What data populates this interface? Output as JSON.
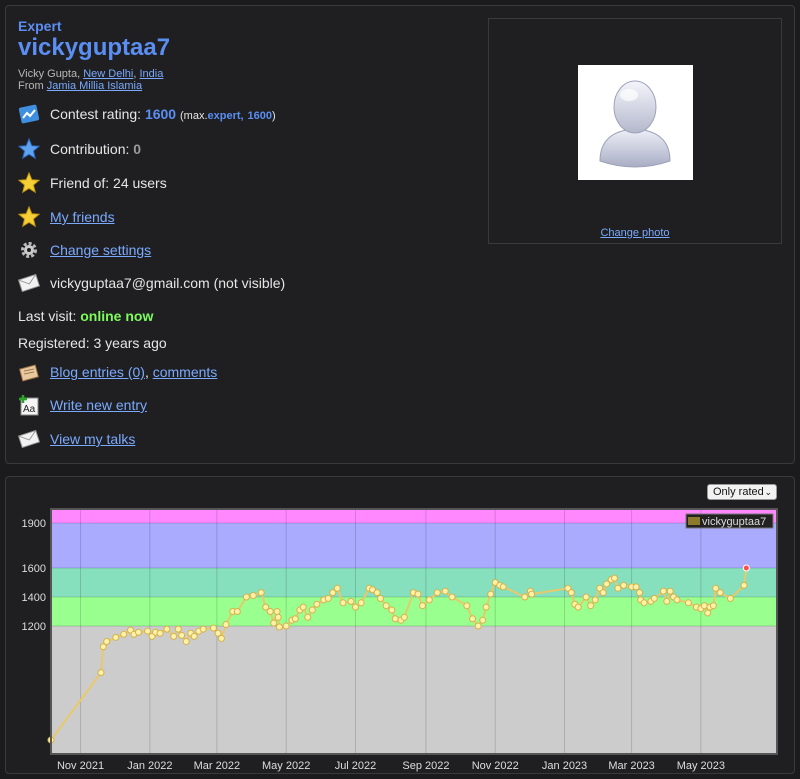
{
  "profile": {
    "rank": "Expert",
    "handle": "vickyguptaa7",
    "name": "Vicky Gupta",
    "city": "New Delhi",
    "country": "India",
    "from_label": "From",
    "organization": "Jamia Millia Islamia",
    "contest_rating_label": "Contest rating:",
    "contest_rating": "1600",
    "max_prefix": "(max.",
    "max_rank": "expert,",
    "max_rating": "1600",
    "max_suffix": ")",
    "contribution_label": "Contribution:",
    "contribution": "0",
    "friend_of": "Friend of: 24 users",
    "my_friends": "My friends",
    "change_settings": "Change settings",
    "email": "vickyguptaa7@gmail.com (not visible)",
    "last_visit_label": "Last visit:",
    "last_visit": "online now",
    "registered": "Registered: 3 years ago",
    "blog_entries": "Blog entries (0)",
    "comments": "comments",
    "write_entry": "Write new entry",
    "view_talks": "View my talks",
    "change_photo": "Change photo"
  },
  "icons": [
    "rating-icon",
    "star-blue-icon",
    "star-gold-icon",
    "star-gold-icon",
    "gear-icon",
    "envelope-icon",
    "blog-icon",
    "write-icon",
    "talks-icon"
  ],
  "graph": {
    "filter_selected": "Only rated"
  },
  "chart_data": {
    "type": "line",
    "legend": "vickyguptaa7",
    "legend_position": "top-right",
    "x_ticks": [
      "Nov 2021",
      "Jan 2022",
      "Mar 2022",
      "May 2022",
      "Jul 2022",
      "Sep 2022",
      "Nov 2022",
      "Jan 2023",
      "Mar 2023",
      "May 2023"
    ],
    "y_ticks": [
      1200,
      1400,
      1600,
      1900
    ],
    "ylim": [
      0,
      2000
    ],
    "bands": [
      {
        "from": 0,
        "to": 1200,
        "color": "#cccccc"
      },
      {
        "from": 1200,
        "to": 1400,
        "color": "#99ff8f"
      },
      {
        "from": 1400,
        "to": 1600,
        "color": "#86dfbd"
      },
      {
        "from": 1600,
        "to": 1900,
        "color": "#aaaaff"
      },
      {
        "from": 1900,
        "to": 2000,
        "color": "#ff88ff"
      }
    ],
    "line_color": "#e8c96a",
    "x_range": [
      "2021-10-06",
      "2023-07-07"
    ],
    "series": [
      {
        "name": "vickyguptaa7",
        "points": [
          [
            "2021-10-06",
            100
          ],
          [
            "2021-11-19",
            750
          ],
          [
            "2021-11-21",
            1000
          ],
          [
            "2021-11-24",
            1050
          ],
          [
            "2021-12-02",
            1090
          ],
          [
            "2021-12-09",
            1120
          ],
          [
            "2021-12-15",
            1160
          ],
          [
            "2021-12-18",
            1120
          ],
          [
            "2021-12-22",
            1140
          ],
          [
            "2021-12-30",
            1150
          ],
          [
            "2022-01-03",
            1100
          ],
          [
            "2022-01-06",
            1140
          ],
          [
            "2022-01-10",
            1130
          ],
          [
            "2022-01-16",
            1170
          ],
          [
            "2022-01-22",
            1100
          ],
          [
            "2022-01-26",
            1170
          ],
          [
            "2022-01-29",
            1110
          ],
          [
            "2022-02-02",
            1050
          ],
          [
            "2022-02-06",
            1130
          ],
          [
            "2022-02-09",
            1100
          ],
          [
            "2022-02-13",
            1150
          ],
          [
            "2022-02-17",
            1170
          ],
          [
            "2022-02-26",
            1180
          ],
          [
            "2022-03-02",
            1130
          ],
          [
            "2022-03-05",
            1080
          ],
          [
            "2022-03-09",
            1210
          ],
          [
            "2022-03-15",
            1300
          ],
          [
            "2022-03-19",
            1300
          ],
          [
            "2022-03-27",
            1400
          ],
          [
            "2022-04-02",
            1410
          ],
          [
            "2022-04-09",
            1430
          ],
          [
            "2022-04-13",
            1330
          ],
          [
            "2022-04-17",
            1300
          ],
          [
            "2022-04-20",
            1220
          ],
          [
            "2022-04-23",
            1300
          ],
          [
            "2022-04-24",
            1260
          ],
          [
            "2022-04-25",
            1190
          ],
          [
            "2022-05-01",
            1200
          ],
          [
            "2022-05-06",
            1240
          ],
          [
            "2022-05-09",
            1250
          ],
          [
            "2022-05-13",
            1310
          ],
          [
            "2022-05-16",
            1330
          ],
          [
            "2022-05-20",
            1260
          ],
          [
            "2022-05-24",
            1310
          ],
          [
            "2022-05-28",
            1350
          ],
          [
            "2022-06-03",
            1380
          ],
          [
            "2022-06-07",
            1390
          ],
          [
            "2022-06-11",
            1430
          ],
          [
            "2022-06-15",
            1460
          ],
          [
            "2022-06-20",
            1360
          ],
          [
            "2022-06-27",
            1370
          ],
          [
            "2022-07-01",
            1330
          ],
          [
            "2022-07-06",
            1360
          ],
          [
            "2022-07-13",
            1460
          ],
          [
            "2022-07-16",
            1450
          ],
          [
            "2022-07-20",
            1430
          ],
          [
            "2022-07-23",
            1390
          ],
          [
            "2022-07-28",
            1340
          ],
          [
            "2022-08-02",
            1310
          ],
          [
            "2022-08-05",
            1250
          ],
          [
            "2022-08-10",
            1240
          ],
          [
            "2022-08-13",
            1260
          ],
          [
            "2022-08-21",
            1430
          ],
          [
            "2022-08-25",
            1420
          ],
          [
            "2022-08-29",
            1340
          ],
          [
            "2022-09-04",
            1380
          ],
          [
            "2022-09-11",
            1430
          ],
          [
            "2022-09-18",
            1440
          ],
          [
            "2022-09-24",
            1400
          ],
          [
            "2022-10-07",
            1340
          ],
          [
            "2022-10-12",
            1250
          ],
          [
            "2022-10-17",
            1200
          ],
          [
            "2022-10-21",
            1240
          ],
          [
            "2022-10-24",
            1330
          ],
          [
            "2022-10-28",
            1420
          ],
          [
            "2022-11-01",
            1500
          ],
          [
            "2022-11-05",
            1480
          ],
          [
            "2022-11-08",
            1470
          ],
          [
            "2022-11-27",
            1400
          ],
          [
            "2022-12-02",
            1440
          ],
          [
            "2022-12-03",
            1420
          ],
          [
            "2023-01-04",
            1460
          ],
          [
            "2023-01-07",
            1430
          ],
          [
            "2023-01-10",
            1350
          ],
          [
            "2023-01-13",
            1330
          ],
          [
            "2023-01-20",
            1400
          ],
          [
            "2023-01-24",
            1340
          ],
          [
            "2023-01-28",
            1380
          ],
          [
            "2023-02-01",
            1460
          ],
          [
            "2023-02-04",
            1430
          ],
          [
            "2023-02-07",
            1490
          ],
          [
            "2023-02-11",
            1520
          ],
          [
            "2023-02-14",
            1530
          ],
          [
            "2023-02-17",
            1460
          ],
          [
            "2023-02-22",
            1480
          ],
          [
            "2023-03-01",
            1470
          ],
          [
            "2023-03-05",
            1470
          ],
          [
            "2023-03-08",
            1430
          ],
          [
            "2023-03-09",
            1380
          ],
          [
            "2023-03-12",
            1360
          ],
          [
            "2023-03-18",
            1370
          ],
          [
            "2023-03-21",
            1390
          ],
          [
            "2023-03-29",
            1440
          ],
          [
            "2023-04-01",
            1370
          ],
          [
            "2023-04-04",
            1440
          ],
          [
            "2023-04-07",
            1400
          ],
          [
            "2023-04-10",
            1380
          ],
          [
            "2023-04-20",
            1360
          ],
          [
            "2023-04-27",
            1330
          ],
          [
            "2023-05-01",
            1320
          ],
          [
            "2023-05-04",
            1340
          ],
          [
            "2023-05-07",
            1290
          ],
          [
            "2023-05-09",
            1330
          ],
          [
            "2023-05-12",
            1340
          ],
          [
            "2023-05-14",
            1460
          ],
          [
            "2023-05-18",
            1430
          ],
          [
            "2023-05-27",
            1390
          ],
          [
            "2023-06-08",
            1480
          ],
          [
            "2023-06-10",
            1600
          ]
        ]
      }
    ]
  }
}
